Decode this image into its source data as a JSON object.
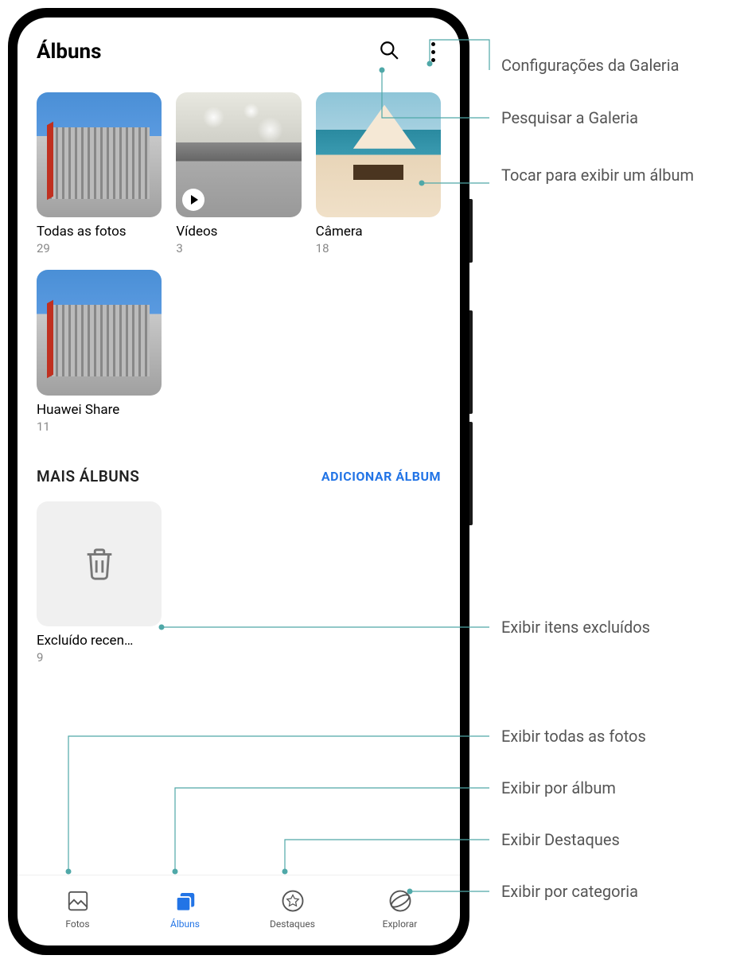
{
  "header": {
    "title": "Álbuns"
  },
  "albums": [
    {
      "title": "Todas as fotos",
      "count": "29"
    },
    {
      "title": "Vídeos",
      "count": "3"
    },
    {
      "title": "Câmera",
      "count": "18"
    },
    {
      "title": "Huawei Share",
      "count": "11"
    }
  ],
  "section": {
    "title": "MAIS ÁLBUNS",
    "add": "ADICIONAR ÁLBUM"
  },
  "trash": {
    "title": "Excluído recen…",
    "count": "9"
  },
  "nav": {
    "photos": "Fotos",
    "albums": "Álbuns",
    "highlights": "Destaques",
    "explore": "Explorar"
  },
  "callouts": {
    "settings": "Configurações da Galeria",
    "search": "Pesquisar a Galeria",
    "tap_album": "Tocar para exibir um álbum",
    "trash": "Exibir itens excluídos",
    "all_photos": "Exibir todas as fotos",
    "by_album": "Exibir por álbum",
    "highlights": "Exibir Destaques",
    "by_category": "Exibir por categoria"
  }
}
